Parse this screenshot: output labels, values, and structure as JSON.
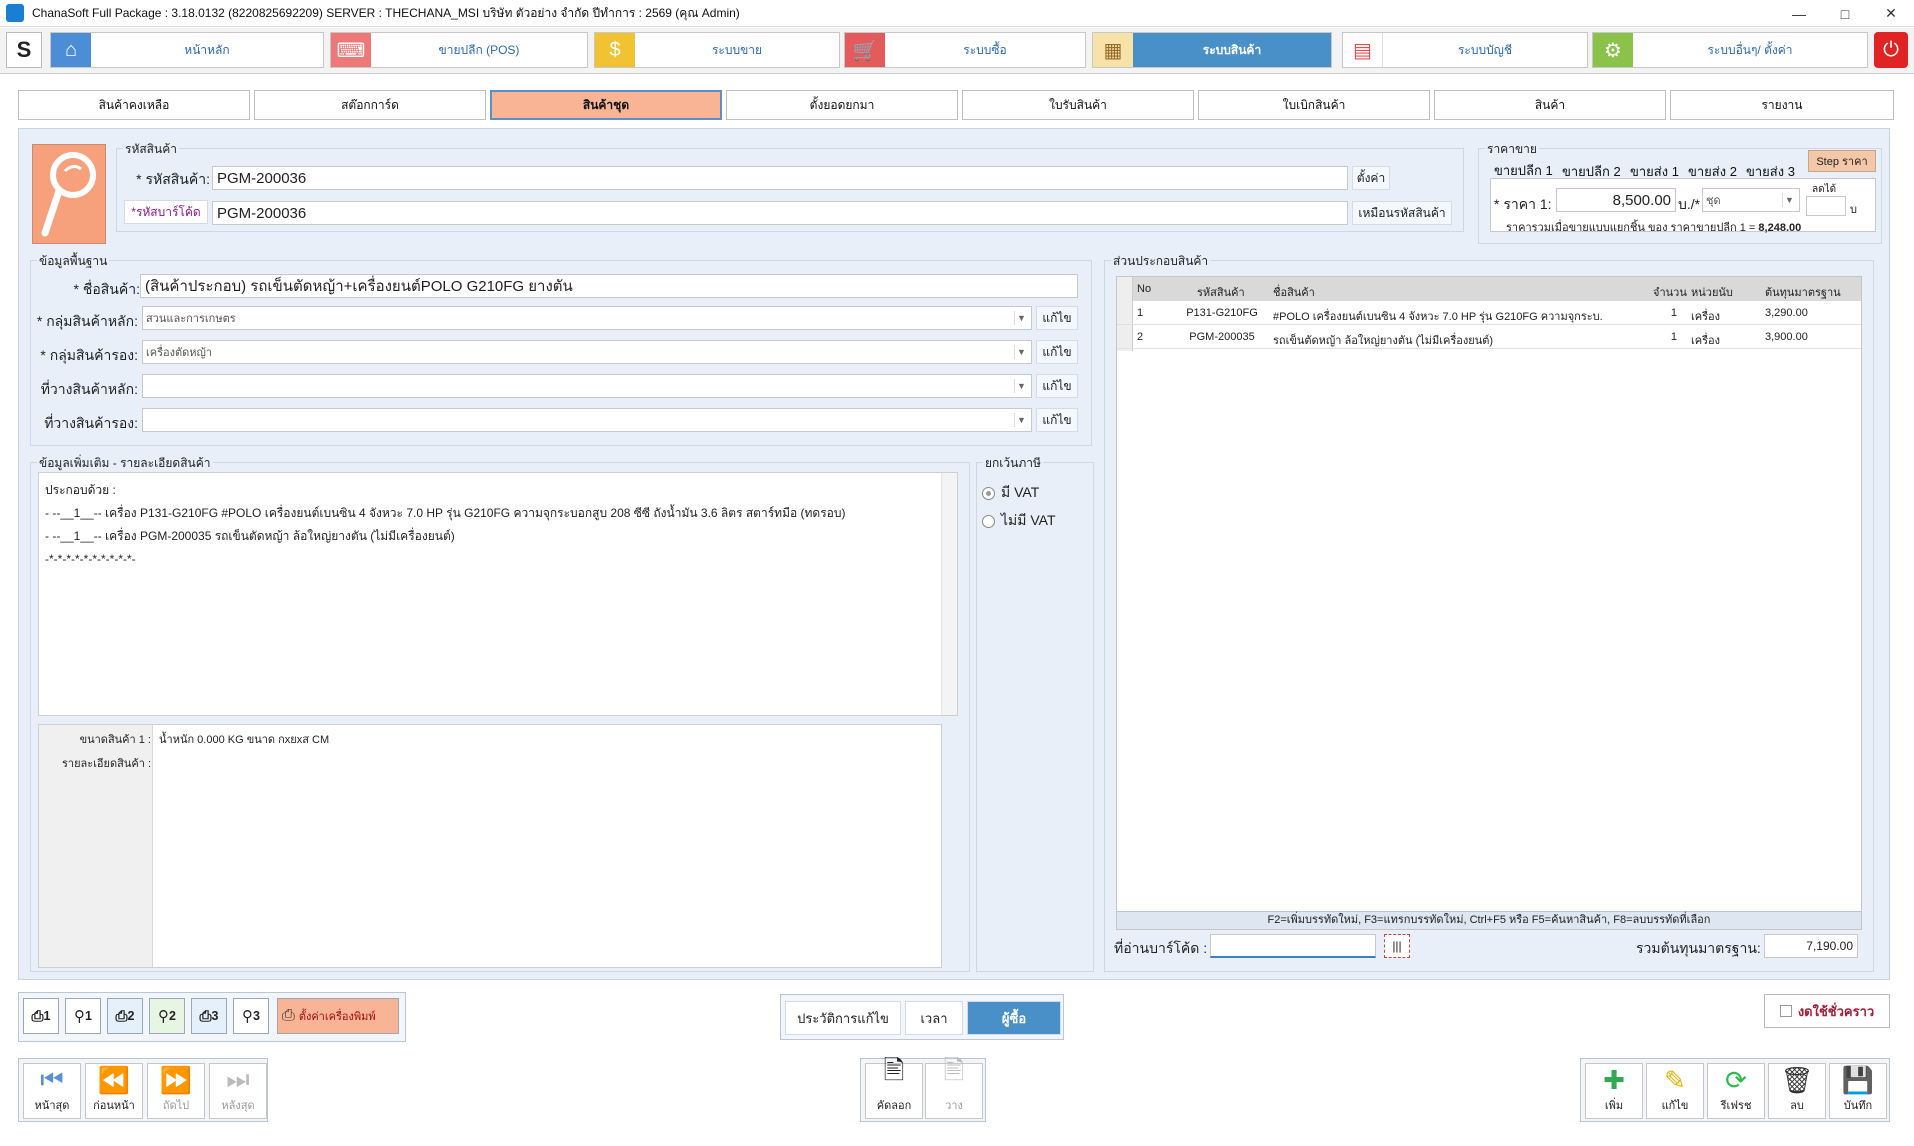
{
  "window": {
    "title": "ChanaSoft Full Package : 3.18.0132 (8220825692209) SERVER : THECHANA_MSI บริษัท ตัวอย่าง จำกัด ปีทำการ : 2569 (คุณ Admin)"
  },
  "modules": [
    {
      "label": "หน้าหลัก",
      "icon": "home-icon"
    },
    {
      "label": "ขายปลีก (POS)",
      "icon": "pos-icon"
    },
    {
      "label": "ระบบขาย",
      "icon": "coin-icon"
    },
    {
      "label": "ระบบซื้อ",
      "icon": "cart-icon"
    },
    {
      "label": "ระบบสินค้า",
      "icon": "box-icon"
    },
    {
      "label": "ระบบบัญชี",
      "icon": "chart-icon"
    },
    {
      "label": "ระบบอื่นๆ/ ตั้งค่า",
      "icon": "gear-icon"
    }
  ],
  "subtabs": [
    "สินค้าคงเหลือ",
    "สต๊อกการ์ด",
    "สินค้าชุด",
    "ตั้งยอดยกมา",
    "ใบรับสินค้า",
    "ใบเบิกสินค้า",
    "สินค้า",
    "รายงาน"
  ],
  "code_group": {
    "title": "รหัสสินค้า",
    "product_code_label": "* รหัสสินค้า:",
    "product_code": "PGM-200036",
    "setting_btn": "ตั้งค่า",
    "barcode_label": "*รหัสบาร์โค้ด",
    "barcode": "PGM-200036",
    "same_btn": "เหมือนรหัสสินค้า"
  },
  "price_group": {
    "title": "ราคาขาย",
    "tabs": [
      "ขายปลีก 1",
      "ขายปลีก 2",
      "ขายส่ง 1",
      "ขายส่ง 2",
      "ขายส่ง 3"
    ],
    "step_btn": "Step ราคา",
    "price_label": "* ราคา 1:",
    "price": "8,500.00",
    "unit_sep": "บ./*",
    "unit": "ชุด",
    "discount_label": "ลดได้",
    "discount_unit": "บ",
    "sum_text": "ราคารวมเมื่อขายแบบแยกชิ้น ของ ราคาขายปลีก 1 =",
    "sum_value": "8,248.00"
  },
  "basic": {
    "title": "ข้อมูลพื้นฐาน",
    "name_label": "* ชื่อสินค้า:",
    "name": "(สินค้าประกอบ) รถเข็นตัดหญ้า+เครื่องยนต์POLO G210FG ยางตัน",
    "main_group_label": "* กลุ่มสินค้าหลัก:",
    "main_group": "สวนและการเกษตร",
    "sub_group_label": "* กลุ่มสินค้ารอง:",
    "sub_group": "เครื่องตัดหญ้า",
    "main_loc_label": "ที่วางสินค้าหลัก:",
    "main_loc": "",
    "sub_loc_label": "ที่วางสินค้ารอง:",
    "sub_loc": "",
    "edit": "แก้ไข"
  },
  "detail": {
    "title": "ข้อมูลเพิ่มเติม - รายละเอียดสินค้า",
    "lines": [
      "ประกอบด้วย :",
      " - --__1__-- เครื่อง   P131-G210FG  #POLO เครื่องยนต์เบนซิน 4 จังหวะ 7.0 HP รุ่น G210FG ความจุกระบอกสูบ 208 ซีซี ถังน้ำมัน 3.6 ลิตร สตาร์ทมือ (ทดรอบ)",
      " - --__1__-- เครื่อง   PGM-200035  รถเข็นตัดหญ้า ล้อใหญ่ยางตัน (ไม่มีเครื่องยนต์)",
      "-*-*-*-*-*-*-*-*-*-*-"
    ],
    "size_label": "ขนาดสินค้า 1 :",
    "size_value": "น้ำหนัก 0.000 KG ขนาด กxยxส CM",
    "desc_label": "รายละเอียดสินค้า :"
  },
  "vat": {
    "title": "ยกเว้นภาษี",
    "options": [
      "มี VAT",
      "ไม่มี VAT"
    ]
  },
  "components": {
    "title": "ส่วนประกอบสินค้า",
    "headers": [
      "No",
      "รหัสสินค้า",
      "ชื่อสินค้า",
      "จำนวน",
      "หน่วยนับ",
      "ต้นทุนมาตรฐาน"
    ],
    "rows": [
      {
        "no": "1",
        "code": "P131-G210FG",
        "name": "#POLO เครื่องยนต์เบนซิน 4 จังหวะ 7.0 HP รุ่น G210FG ความจุกระบ...",
        "qty": "1",
        "unit": "เครื่อง",
        "cost": "3,290.00"
      },
      {
        "no": "2",
        "code": "PGM-200035",
        "name": "รถเข็นตัดหญ้า ล้อใหญ่ยางตัน (ไม่มีเครื่องยนต์)",
        "qty": "1",
        "unit": "เครื่อง",
        "cost": "3,900.00"
      }
    ],
    "hint": "F2=เพิ่มบรรทัดใหม่,   F3=แทรกบรรทัดใหม่,   Ctrl+F5 หรือ F5=ค้นหาสินค้า,   F8=ลบบรรทัดที่เลือก",
    "barcode_reader_label": "ที่อ่านบาร์โค้ด :",
    "total_label": "รวมต้นทุนมาตรฐาน:",
    "total_value": "7,190.00"
  },
  "print_toolbar": {
    "buttons": [
      "1",
      "1",
      "2",
      "2",
      "3",
      "3"
    ],
    "setting_label": "ตั้งค่าเครื่องพิมพ์"
  },
  "history_tabs": [
    "ประวัติการแก้ไข",
    "เวลา",
    "ผู้ซื้อ"
  ],
  "suspend_label": "งดใช้ชั่วคราว",
  "nav_buttons": [
    "หน้าสุด",
    "ก่อนหน้า",
    "ถัดไป",
    "หลังสุด"
  ],
  "clip_buttons": [
    "คัดลอก",
    "วาง"
  ],
  "action_buttons": [
    "เพิ่ม",
    "แก้ไข",
    "รีเฟรช",
    "ลบ",
    "บันทึก"
  ]
}
